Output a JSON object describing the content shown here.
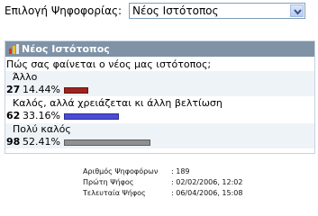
{
  "poll_selector": {
    "label": "Επιλογή Ψηφοφορίας:",
    "selected": "Νέος Ιστότοπος"
  },
  "poll": {
    "title": "Νέος Ιστότοπος",
    "question": "Πώς σας φαίνεται ο νέος μας ιστότοπος;",
    "options": [
      {
        "label": "Άλλο",
        "count": "27",
        "percent_text": "14.44%",
        "percent": 14.44,
        "color": "#9b2420"
      },
      {
        "label": "Καλός, αλλά χρειάζεται κι άλλη βελτίωση",
        "count": "62",
        "percent_text": "33.16%",
        "percent": 33.16,
        "color": "#4b4bd6"
      },
      {
        "label": "Πολύ καλός",
        "count": "98",
        "percent_text": "52.41%",
        "percent": 52.41,
        "color": "#909090"
      }
    ]
  },
  "stats": {
    "total_label": "Αριθμός Ψηφοφόρων",
    "total_value": ": 189",
    "first_label": "Πρώτη Ψήφος",
    "first_value": ": 02/02/2006, 12:02",
    "last_label": "Τελευταία Ψήφος",
    "last_value": ": 06/04/2006, 15:08"
  }
}
